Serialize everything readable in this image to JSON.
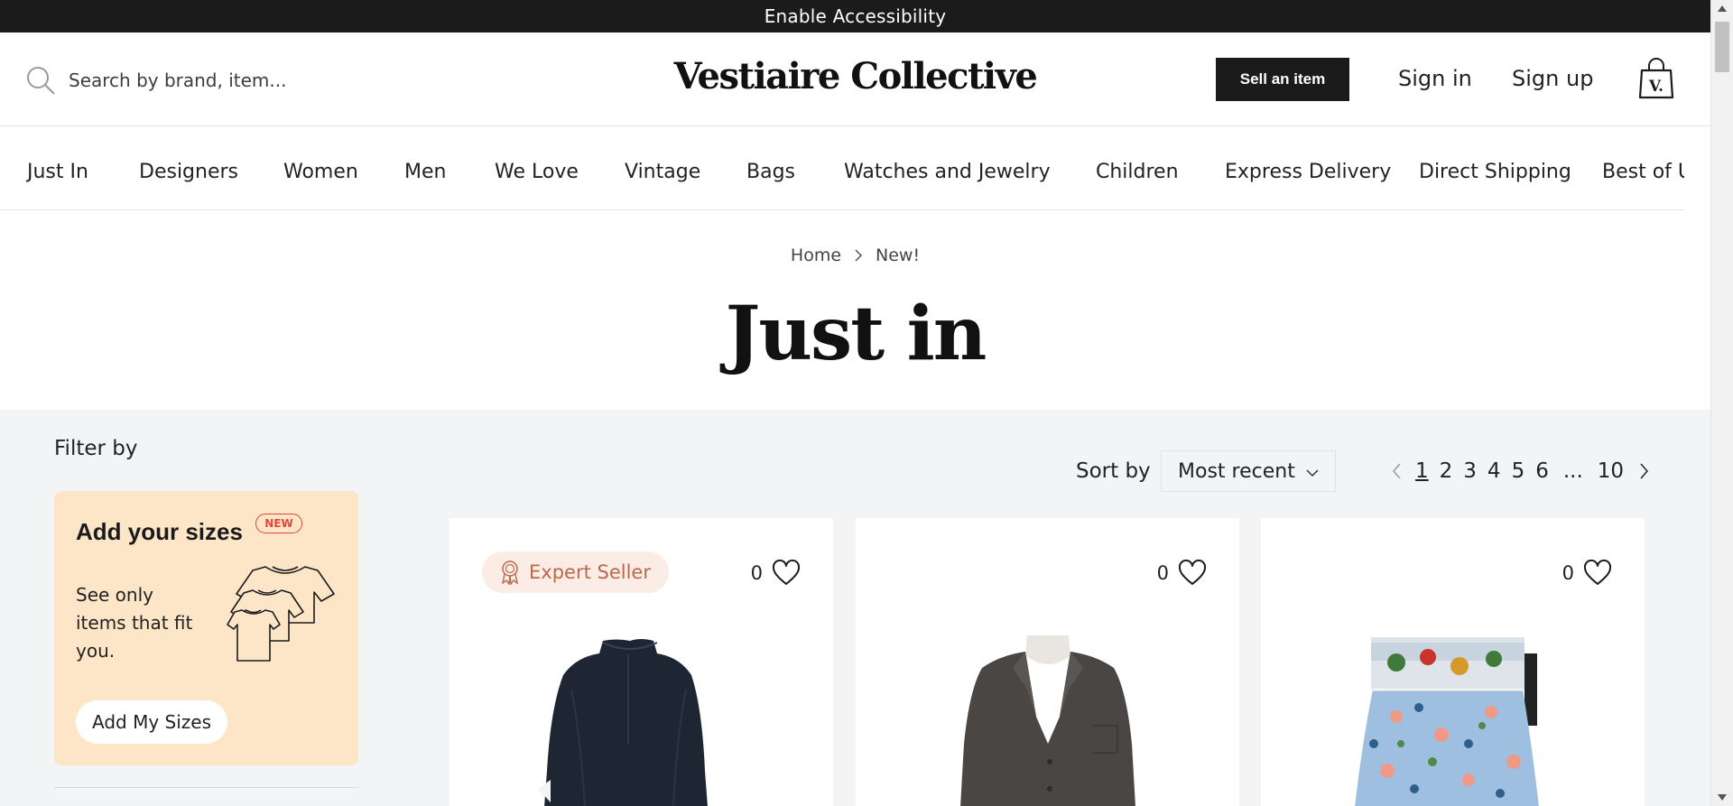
{
  "accessibility_bar": {
    "label": "Enable Accessibility"
  },
  "header": {
    "search_placeholder": "Search by brand, item...",
    "logo": "Vestiaire Collective",
    "sell_button": "Sell an item",
    "sign_in": "Sign in",
    "sign_up": "Sign up"
  },
  "nav": {
    "items": [
      "Just In",
      "Designers",
      "Women",
      "Men",
      "We Love",
      "Vintage",
      "Bags",
      "Watches and Jewelry",
      "Children",
      "Express Delivery",
      "Direct Shipping",
      "Best of U"
    ]
  },
  "breadcrumb": {
    "home": "Home",
    "current": "New!"
  },
  "page_title": "Just in",
  "filters": {
    "title": "Filter by",
    "sizes_card": {
      "title": "Add your sizes",
      "badge": "NEW",
      "description": "See only items that fit you.",
      "button": "Add My Sizes"
    }
  },
  "sort": {
    "label": "Sort by",
    "selected": "Most recent"
  },
  "pagination": {
    "pages": [
      "1",
      "2",
      "3",
      "4",
      "5",
      "6"
    ],
    "ellipsis": "...",
    "last": "10",
    "current": "1"
  },
  "products": [
    {
      "badge": "Expert Seller",
      "likes": "0",
      "image": "navy-blouse"
    },
    {
      "likes": "0",
      "image": "grey-blazer"
    },
    {
      "likes": "0",
      "image": "floral-skirt"
    }
  ],
  "colors": {
    "topbar": "#1b1b1b",
    "content_bg": "#f3f4f5",
    "sizes_card_bg": "#fde6c8",
    "new_badge": "#e2473a",
    "expert_text": "#b9694c"
  }
}
